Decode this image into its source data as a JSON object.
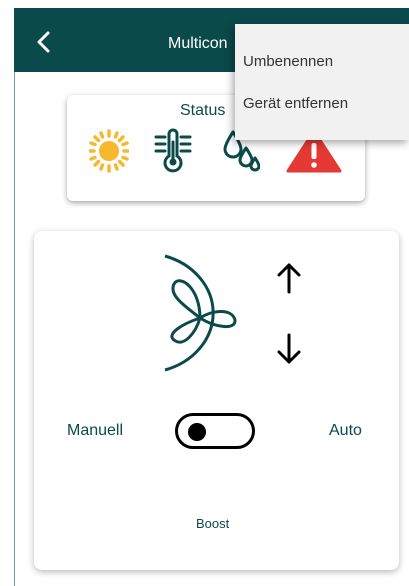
{
  "app_bar": {
    "title": "Multicon",
    "back_icon": "chevron-left-icon"
  },
  "menu": {
    "items": [
      {
        "label": "Umbenennen"
      },
      {
        "label": "Gerät entfernen"
      }
    ]
  },
  "status": {
    "label": "Status",
    "icons": [
      "sun-icon",
      "thermometer-icon",
      "water-drops-icon",
      "warning-icon"
    ],
    "colors": {
      "sun": "#f6b82d",
      "teal": "#0b4a4a",
      "warning": "#e53935"
    }
  },
  "control": {
    "fan_icon": "fan-icon",
    "increase_icon": "arrow-up-icon",
    "decrease_icon": "arrow-down-icon",
    "manual_label": "Manuell",
    "auto_label": "Auto",
    "toggle_state": "Manuell",
    "boost_label": "Boost"
  },
  "theme": {
    "primary": "#0b4a4a",
    "background": "#ffffff",
    "menu_bg": "#f1f1f1"
  }
}
